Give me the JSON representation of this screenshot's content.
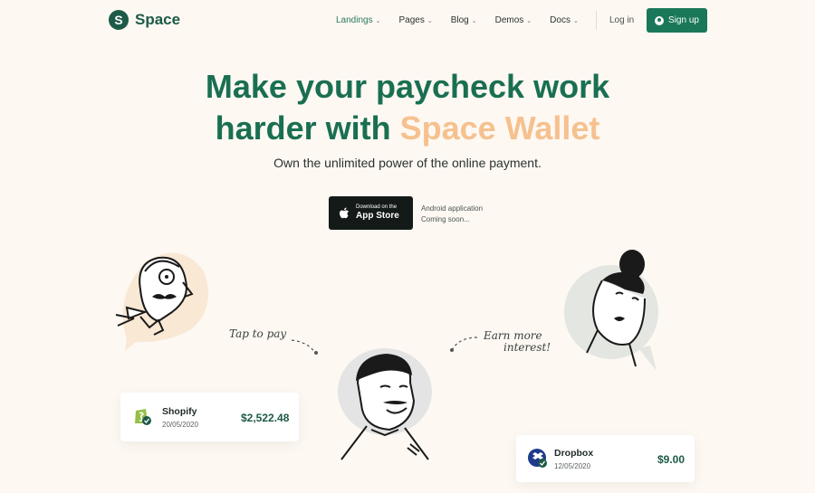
{
  "brand": {
    "initial": "S",
    "name": "Space"
  },
  "nav": {
    "items": [
      {
        "label": "Landings",
        "active": true
      },
      {
        "label": "Pages",
        "active": false
      },
      {
        "label": "Blog",
        "active": false
      },
      {
        "label": "Demos",
        "active": false
      },
      {
        "label": "Docs",
        "active": false
      }
    ],
    "login": "Log in",
    "signup": "Sign up"
  },
  "hero": {
    "title_line1": "Make your paycheck work",
    "title_line2_prefix": "harder with ",
    "title_line2_accent": "Space Wallet",
    "subtitle": "Own the unlimited power of the online payment."
  },
  "appstore": {
    "small": "Download on the",
    "big": "App Store"
  },
  "android": {
    "line1": "Android application",
    "line2": "Coming soon..."
  },
  "annotations": {
    "tap": "Tap to pay",
    "earn_line1": "Earn more",
    "earn_line2": "interest!"
  },
  "transactions": [
    {
      "name": "Shopify",
      "date": "20/05/2020",
      "amount": "$2,522.48",
      "icon": "shopify-icon"
    },
    {
      "name": "Dropbox",
      "date": "12/05/2020",
      "amount": "$9.00",
      "icon": "dropbox-icon"
    }
  ],
  "colors": {
    "brand": "#1a7858",
    "accent": "#f6c18f",
    "dark": "#1d5a48"
  }
}
